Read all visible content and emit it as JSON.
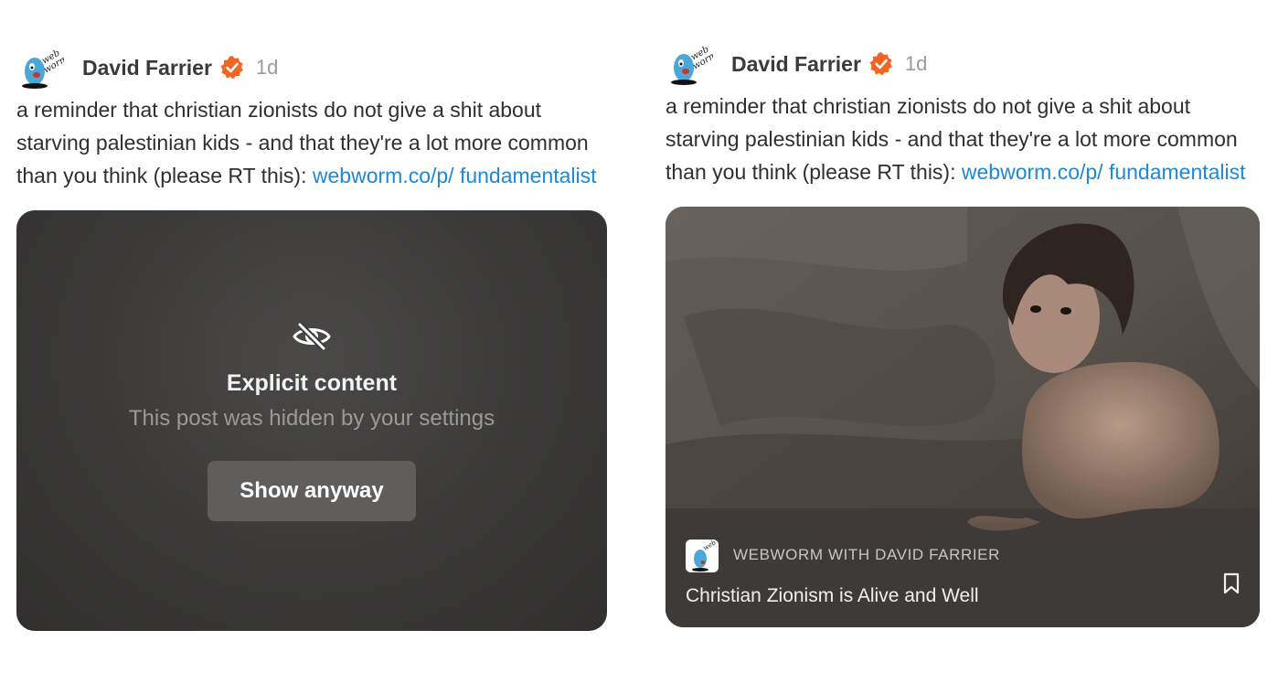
{
  "left_post": {
    "author": "David Farrier",
    "time": "1d",
    "text": "a reminder that christian zionists do not give a shit about starving palestinian kids - and that they're a lot more common than you think (please RT this): ",
    "link_text": "webworm.co/p/ fundamentalist",
    "hidden_media": {
      "title": "Explicit content",
      "subtitle": "This post was hidden by your settings",
      "button_label": "Show anyway"
    }
  },
  "right_post": {
    "author": "David Farrier",
    "time": "1d",
    "text": "a reminder that christian zionists do not give a shit about starving palestinian kids - and that they're a lot more common than you think (please RT this): ",
    "link_text": "webworm.co/p/ fundamentalist",
    "card": {
      "publication": "WEBWORM WITH DAVID FARRIER",
      "title": "Christian Zionism is Alive and Well"
    }
  },
  "colors": {
    "link": "#1e88d8",
    "verified": "#f26522",
    "hidden_card_bg": "#3a3938",
    "button_bg": "#5f5e5d"
  },
  "icons": [
    "webworm-avatar",
    "verified-badge-icon",
    "eye-slash-icon",
    "bookmark-icon"
  ]
}
